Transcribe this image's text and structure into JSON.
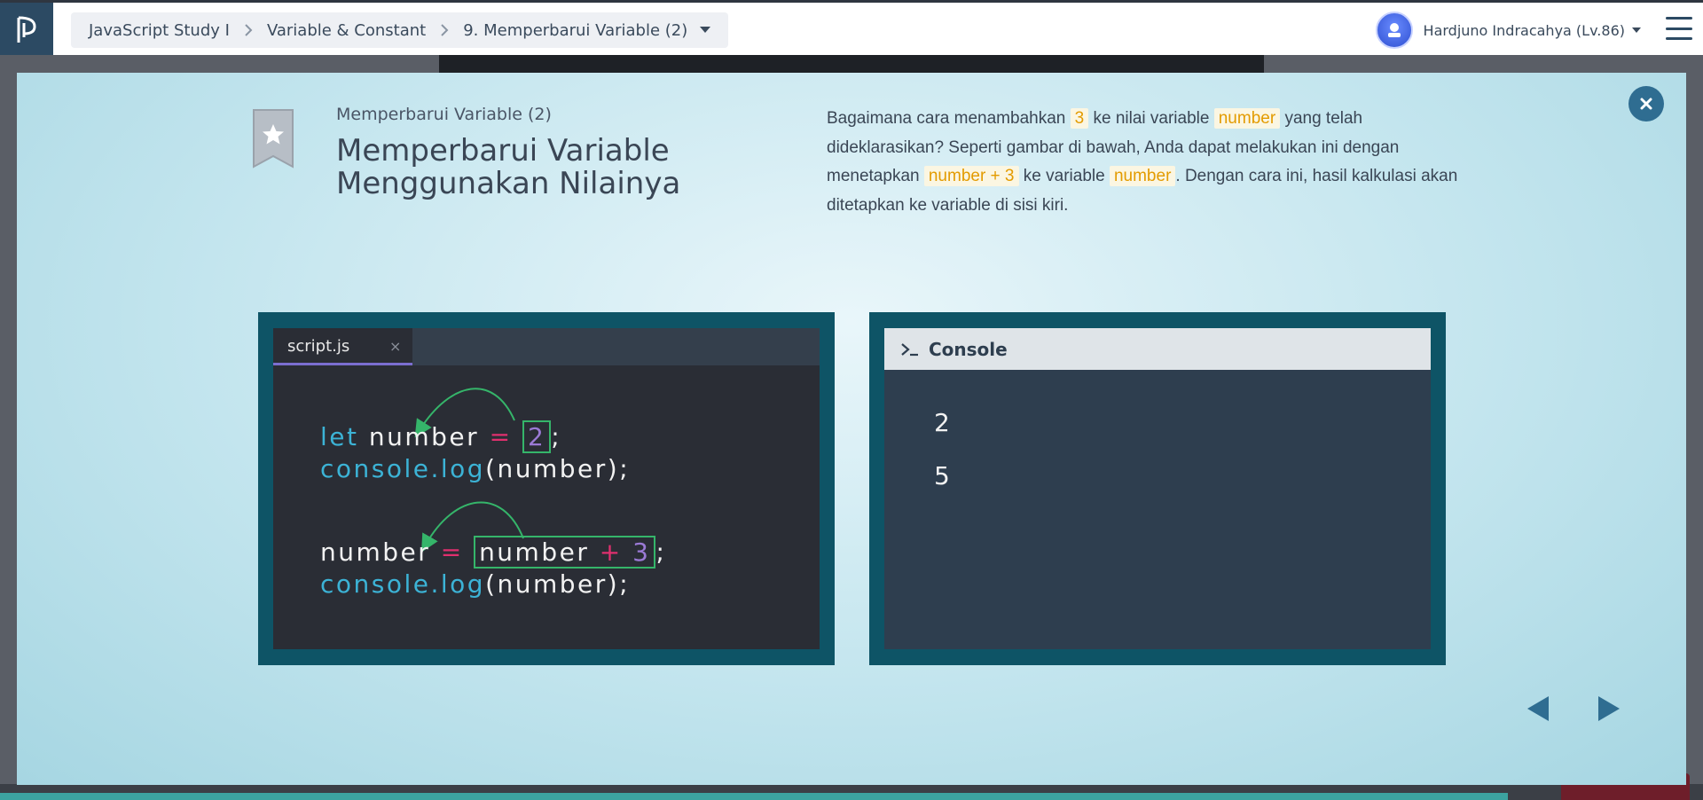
{
  "header": {
    "logo_icon": "progate-logo-icon",
    "breadcrumb": [
      "JavaScript Study I",
      "Variable & Constant",
      "9. Memperbarui Variable (2)"
    ],
    "user": {
      "name": "Hardjuno Indracahya (Lv.86)",
      "avatar_icon": "user-avatar-icon"
    }
  },
  "slide": {
    "subtitle": "Memperbarui Variable (2)",
    "title_line1": "Memperbarui Variable",
    "title_line2": "Menggunakan Nilainya",
    "description": {
      "p1": "Bagaimana cara menambahkan",
      "h1": "3",
      "p2": "ke nilai variable",
      "h2": "number",
      "p3": "yang telah dideklarasikan? Seperti gambar di bawah, Anda dapat melakukan ini dengan menetapkan",
      "h3": "number + 3",
      "p4": "ke variable",
      "h4": "number",
      "p5": ". Dengan cara ini, hasil kalkulasi akan ditetapkan ke variable di sisi kiri."
    },
    "highlight_color": "#e39b00"
  },
  "editor": {
    "tab_label": "script.js",
    "tab_close": "×",
    "code": {
      "l1_kw": "let",
      "l1_var": " number ",
      "l1_op": "=",
      "l1_val": "2",
      "l1_end": ";",
      "l2_obj": "console.log",
      "l2_args": "(number);",
      "l3_var": "number ",
      "l3_op": "=",
      "l3_expr_a": "number ",
      "l3_expr_op": "+",
      "l3_expr_b": " 3",
      "l3_end": ";",
      "l4_obj": "console.log",
      "l4_args": "(number);"
    },
    "colors": {
      "keyword": "#3cb3d6",
      "operator": "#e0306e",
      "number": "#9b7ad6",
      "arrow": "#35b56a"
    }
  },
  "console": {
    "title": "Console",
    "outputs": [
      "2",
      "5"
    ]
  }
}
